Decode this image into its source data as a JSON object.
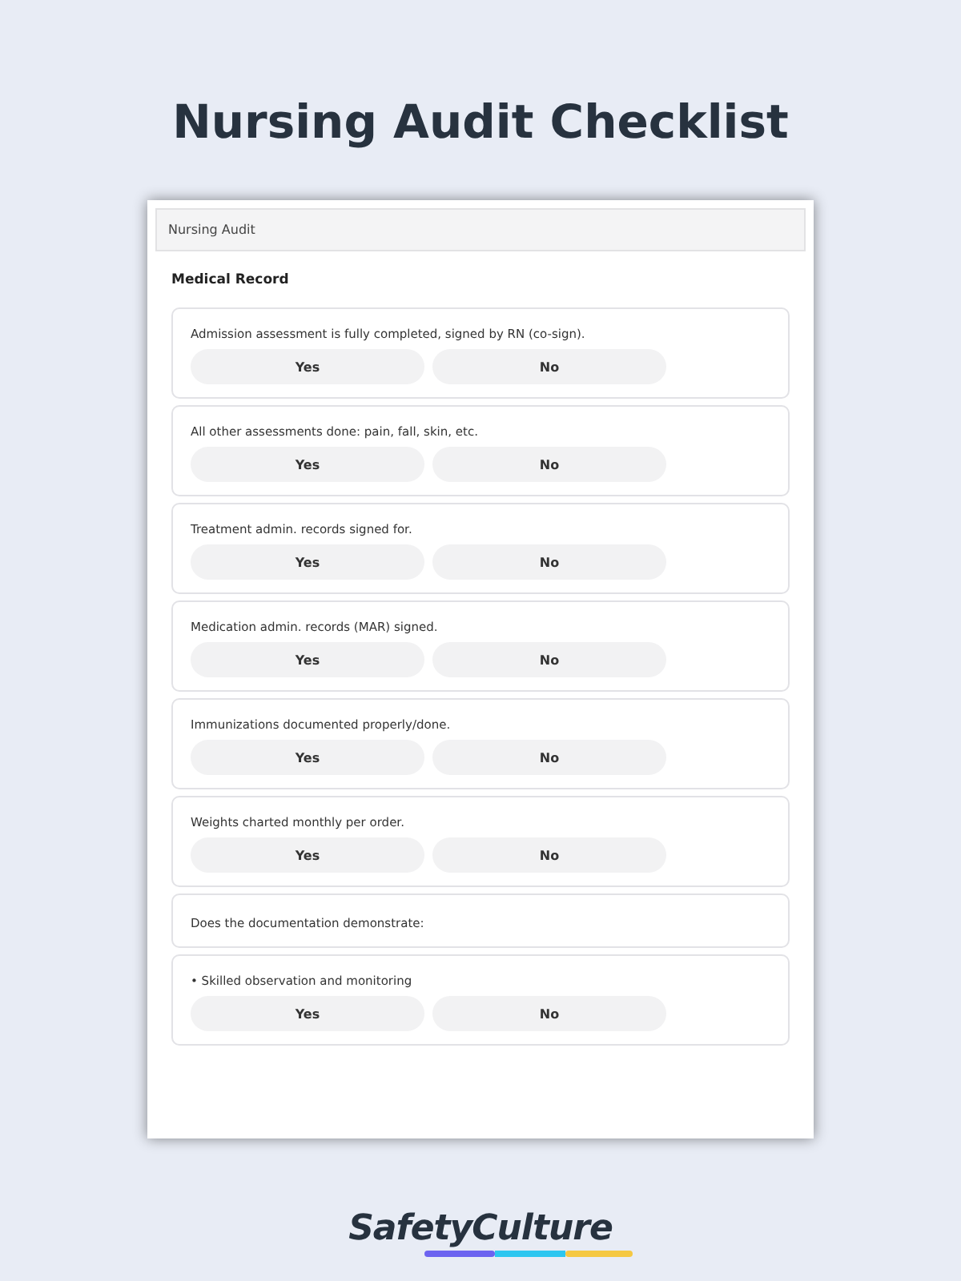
{
  "title": "Nursing Audit Checklist",
  "form": {
    "header": "Nursing Audit",
    "section": "Medical Record",
    "items": [
      {
        "kind": "question",
        "text": "Admission assessment is fully completed, signed by RN (co-sign).",
        "options": [
          {
            "label": "Yes",
            "selected": false
          },
          {
            "label": "No",
            "selected": false
          }
        ]
      },
      {
        "kind": "question",
        "text": "All other assessments done: pain, fall, skin, etc.",
        "options": [
          {
            "label": "Yes",
            "selected": false
          },
          {
            "label": "No",
            "selected": false
          }
        ]
      },
      {
        "kind": "question",
        "text": "Treatment admin. records signed for.",
        "options": [
          {
            "label": "Yes",
            "selected": false
          },
          {
            "label": "No",
            "selected": false
          }
        ]
      },
      {
        "kind": "question",
        "text": "Medication admin. records (MAR) signed.",
        "options": [
          {
            "label": "Yes",
            "selected": false
          },
          {
            "label": "No",
            "selected": false
          }
        ]
      },
      {
        "kind": "question",
        "text": "Immunizations documented properly/done.",
        "options": [
          {
            "label": "Yes",
            "selected": false
          },
          {
            "label": "No",
            "selected": false
          }
        ]
      },
      {
        "kind": "question",
        "text": "Weights charted monthly per order.",
        "options": [
          {
            "label": "Yes",
            "selected": false
          },
          {
            "label": "No",
            "selected": false
          }
        ]
      },
      {
        "kind": "note",
        "text": "Does the documentation demonstrate:"
      },
      {
        "kind": "question",
        "text": "• Skilled observation and monitoring",
        "options": [
          {
            "label": "Yes",
            "selected": false
          },
          {
            "label": "No",
            "selected": false
          }
        ]
      }
    ]
  },
  "brand": {
    "name": "SafetyCulture"
  }
}
